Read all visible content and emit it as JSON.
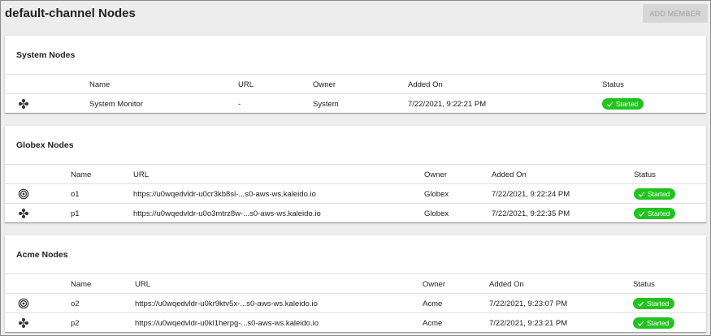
{
  "page": {
    "title": "default-channel Nodes",
    "add_member_label": "ADD MEMBER"
  },
  "colors": {
    "started": "#21c41f",
    "button_bg": "#d6d6d6"
  },
  "cards": [
    {
      "title": "System Nodes",
      "headers": {
        "name": "Name",
        "url": "URL",
        "owner": "Owner",
        "added_on": "Added On",
        "status": "Status"
      },
      "rows": [
        {
          "icon": "nodes-cluster-icon",
          "name": "System Monitor",
          "url": "-",
          "owner": "System",
          "added_on": "7/22/2021, 9:22:21 PM",
          "status": "Started"
        }
      ]
    },
    {
      "title": "Globex Nodes",
      "headers": {
        "name": "Name",
        "url": "URL",
        "owner": "Owner",
        "added_on": "Added On",
        "status": "Status"
      },
      "rows": [
        {
          "icon": "target-icon",
          "name": "o1",
          "url": "https://u0wqedvldr-u0cr3kb8sl-...s0-aws-ws.kaleido.io",
          "owner": "Globex",
          "added_on": "7/22/2021, 9:22:24 PM",
          "status": "Started"
        },
        {
          "icon": "nodes-cluster-icon",
          "name": "p1",
          "url": "https://u0wqedvldr-u0o3mtrz8w-...s0-aws-ws.kaleido.io",
          "owner": "Globex",
          "added_on": "7/22/2021, 9:22:35 PM",
          "status": "Started"
        }
      ]
    },
    {
      "title": "Acme Nodes",
      "headers": {
        "name": "Name",
        "url": "URL",
        "owner": "Owner",
        "added_on": "Added On",
        "status": "Status"
      },
      "rows": [
        {
          "icon": "target-icon",
          "name": "o2",
          "url": "https://u0wqedvldr-u0kr9ktv5x-...s0-aws-ws.kaleido.io",
          "owner": "Acme",
          "added_on": "7/22/2021, 9:23:07 PM",
          "status": "Started"
        },
        {
          "icon": "nodes-cluster-icon",
          "name": "p2",
          "url": "https://u0wqedvldr-u0kl1herpg-...s0-aws-ws.kaleido.io",
          "owner": "Acme",
          "added_on": "7/22/2021, 9:23:21 PM",
          "status": "Started"
        }
      ]
    }
  ]
}
